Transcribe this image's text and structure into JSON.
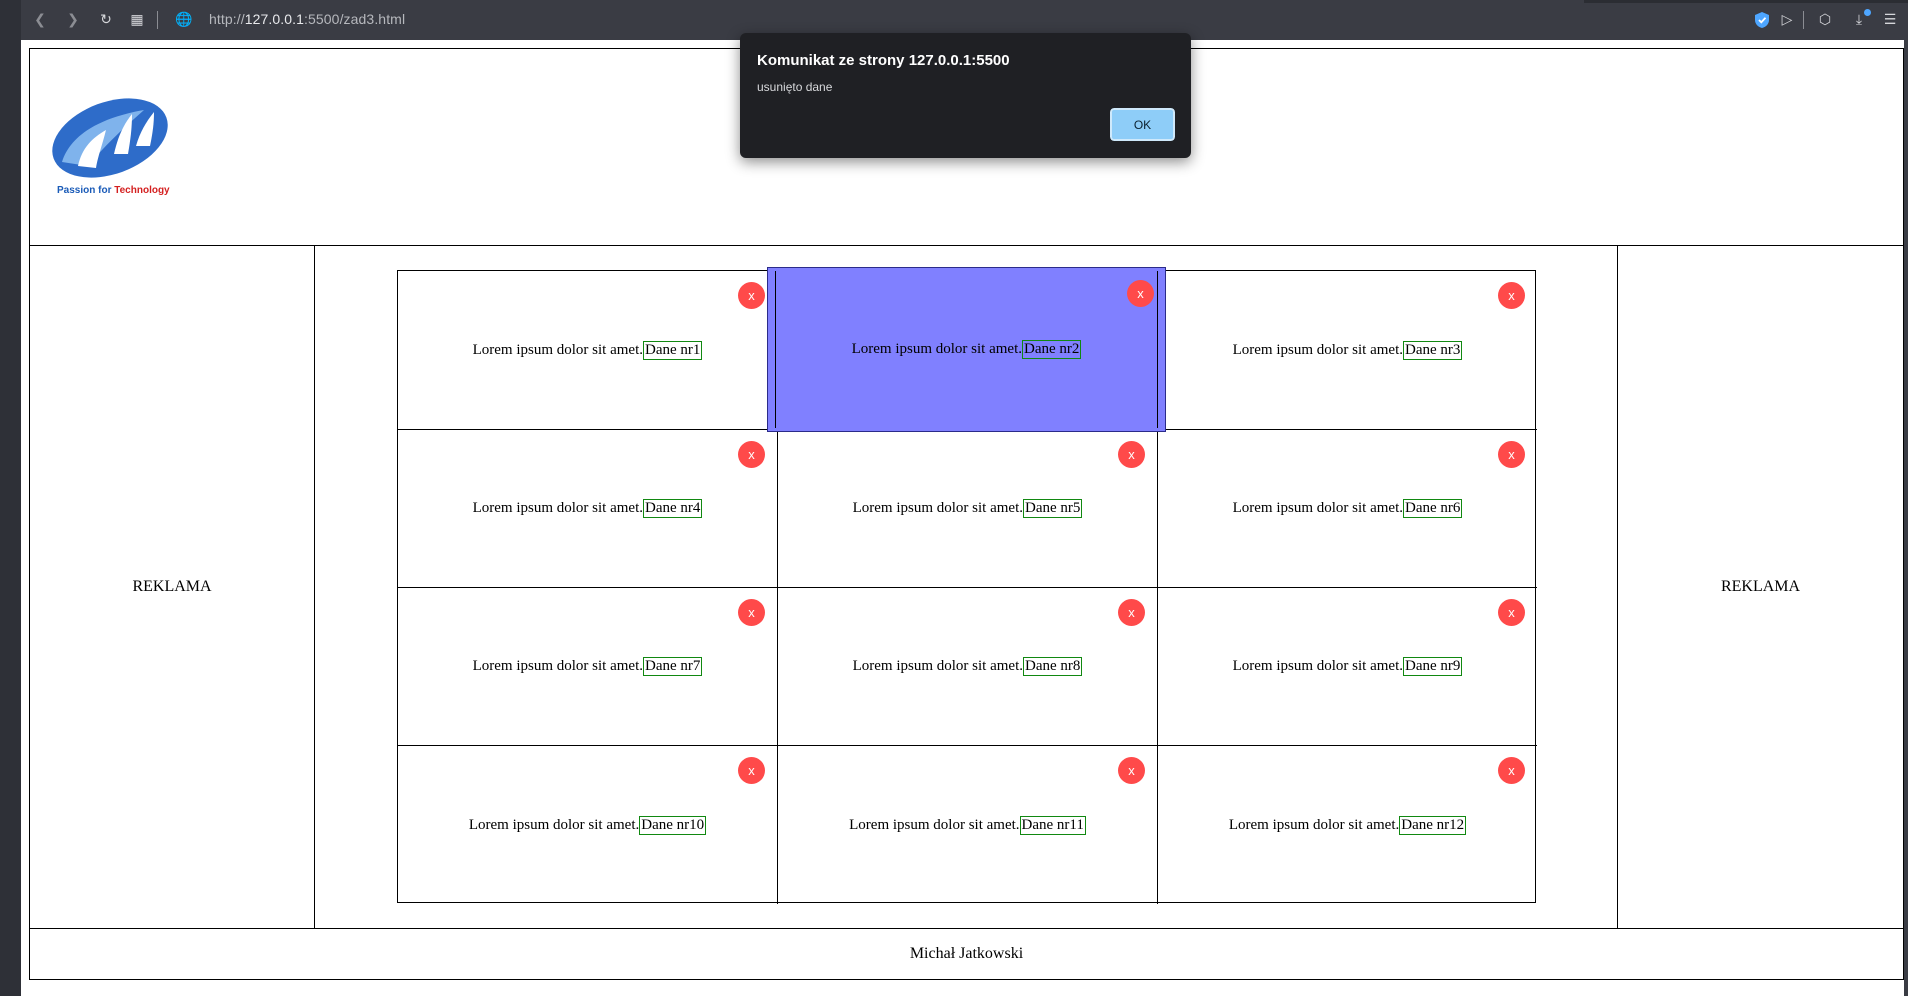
{
  "browser": {
    "url_prefix": "http://",
    "url_host": "127.0.0.1",
    "url_rest": ":5500/zad3.html"
  },
  "header": {
    "logo_caption_main": "Passion for ",
    "logo_caption_accent": "Technology"
  },
  "sidebar_left": {
    "label": "REKLAMA"
  },
  "sidebar_right": {
    "label": "REKLAMA"
  },
  "footer": {
    "label": "Michał Jatkowski"
  },
  "cells": [
    {
      "text": "Lorem ipsum dolor sit amet.",
      "tag": "Dane nr1",
      "close": "x"
    },
    {
      "text": "Lorem ipsum dolor sit amet.",
      "tag": "Dane nr2",
      "close": "x"
    },
    {
      "text": "Lorem ipsum dolor sit amet.",
      "tag": "Dane nr3",
      "close": "x"
    },
    {
      "text": "Lorem ipsum dolor sit amet.",
      "tag": "Dane nr4",
      "close": "x"
    },
    {
      "text": "Lorem ipsum dolor sit amet.",
      "tag": "Dane nr5",
      "close": "x"
    },
    {
      "text": "Lorem ipsum dolor sit amet.",
      "tag": "Dane nr6",
      "close": "x"
    },
    {
      "text": "Lorem ipsum dolor sit amet.",
      "tag": "Dane nr7",
      "close": "x"
    },
    {
      "text": "Lorem ipsum dolor sit amet.",
      "tag": "Dane nr8",
      "close": "x"
    },
    {
      "text": "Lorem ipsum dolor sit amet.",
      "tag": "Dane nr9",
      "close": "x"
    },
    {
      "text": "Lorem ipsum dolor sit amet.",
      "tag": "Dane nr10",
      "close": "x"
    },
    {
      "text": "Lorem ipsum dolor sit amet.",
      "tag": "Dane nr11",
      "close": "x"
    },
    {
      "text": "Lorem ipsum dolor sit amet.",
      "tag": "Dane nr12",
      "close": "x"
    }
  ],
  "alert": {
    "title": "Komunikat ze strony 127.0.0.1:5500",
    "message": "usunięto dane",
    "ok_label": "OK"
  },
  "colors": {
    "dragged_cell_bg": "#8080ff",
    "close_button_bg": "#ff4a4a",
    "tag_border": "#118811",
    "ok_button_bg": "#8ecdf8"
  }
}
